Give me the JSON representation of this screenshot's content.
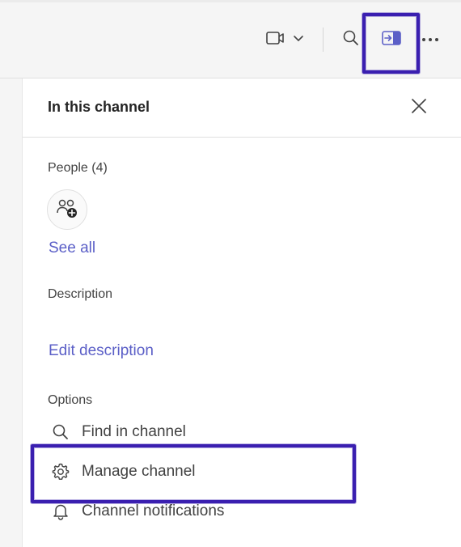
{
  "toolbar": {
    "video_icon": "video-camera-icon",
    "video_dropdown_icon": "chevron-down-icon",
    "search_icon": "search-icon",
    "panel_icon": "open-pane-icon",
    "more_icon": "more-horizontal-icon"
  },
  "panel": {
    "title": "In this channel",
    "close_icon": "close-icon",
    "people": {
      "label": "People (4)",
      "add_icon": "add-people-icon",
      "see_all": "See all"
    },
    "description": {
      "label": "Description",
      "edit_link": "Edit description"
    },
    "options": {
      "label": "Options",
      "items": [
        {
          "label": "Find in channel",
          "icon": "search-icon"
        },
        {
          "label": "Manage channel",
          "icon": "gear-icon"
        },
        {
          "label": "Channel notifications",
          "icon": "bell-icon"
        }
      ]
    }
  },
  "colors": {
    "link": "#5b5fc7",
    "annotation": "#3a1fb0",
    "accent_icon": "#5b5fc7"
  }
}
